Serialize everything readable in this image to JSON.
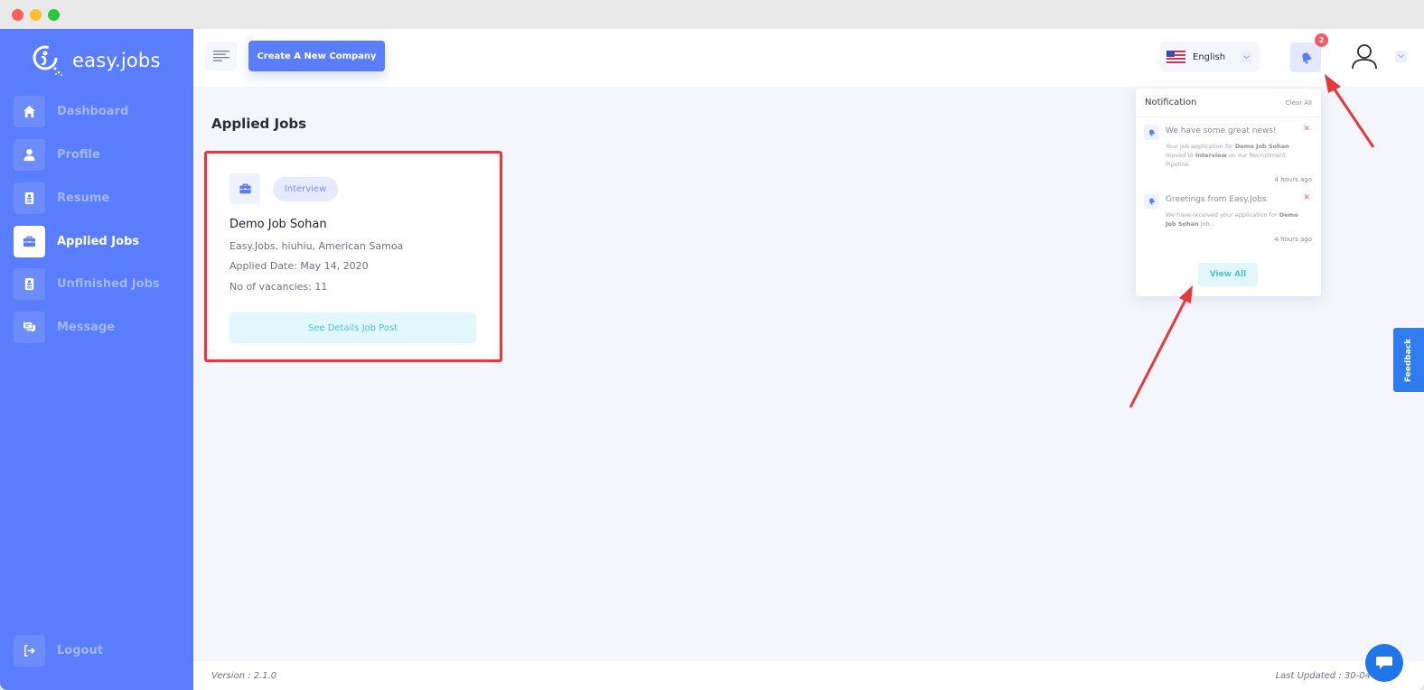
{
  "window": {
    "traffic_lights": [
      "close",
      "minimize",
      "maximize"
    ]
  },
  "brand": {
    "name": "easy.jobs",
    "logo_icon": "easyjobs-logo-icon",
    "color": "#597dfc"
  },
  "sidebar": {
    "items": [
      {
        "label": "Dashboard",
        "icon": "home-icon",
        "active": false
      },
      {
        "label": "Profile",
        "icon": "user-icon",
        "active": false
      },
      {
        "label": "Resume",
        "icon": "resume-icon",
        "active": false
      },
      {
        "label": "Applied Jobs",
        "icon": "briefcase-icon",
        "active": true
      },
      {
        "label": "Unfinished Jobs",
        "icon": "resume-icon",
        "active": false
      },
      {
        "label": "Message",
        "icon": "chat-icon",
        "active": false
      }
    ],
    "logout": {
      "label": "Logout",
      "icon": "logout-icon"
    }
  },
  "topbar": {
    "menu_icon": "hamburger-icon",
    "create_company_label": "Create A New Company",
    "language": {
      "selected": "English",
      "flag": "us-flag-icon"
    },
    "notifications": {
      "count": "2",
      "icon": "bell-icon"
    },
    "user_icon": "user-avatar-icon"
  },
  "page": {
    "title": "Applied Jobs"
  },
  "job_card": {
    "status": "Interview",
    "title": "Demo Job Sohan",
    "location": "Easy.Jobs, hiuhiu, American Samoa",
    "applied_date": "Applied Date: May 14, 2020",
    "vacancies": "No of vacancies: 11",
    "details_button": "See Details Job Post"
  },
  "notification_panel": {
    "title": "Notification",
    "clear_all": "Clear All",
    "items": [
      {
        "title": "We have some great news!",
        "body_parts": [
          "Your job application for ",
          "Demo Job Sohan",
          " moved to ",
          "Interview",
          " on our Recruitment Pipeline."
        ],
        "time": "4 hours ago"
      },
      {
        "title": "Greetings from Easy.Jobs",
        "body_parts": [
          "We have received your application for ",
          "Demo Job Sohan",
          " job."
        ],
        "time": "4 hours ago"
      }
    ],
    "view_all": "View All"
  },
  "feedback_label": "Feedback",
  "footer": {
    "version": "Version : 2.1.0",
    "last_updated": "Last Updated : 30-04-2020"
  },
  "annotation_color": "#e8383d"
}
